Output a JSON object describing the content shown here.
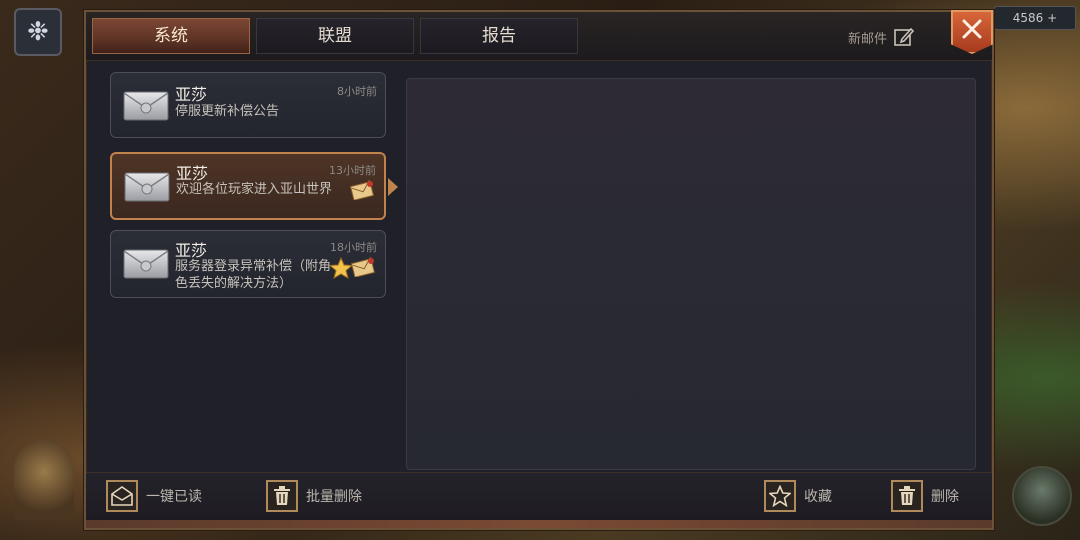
{
  "tabs": [
    {
      "label": "系统",
      "active": true
    },
    {
      "label": "联盟",
      "active": false
    },
    {
      "label": "报告",
      "active": false
    }
  ],
  "header": {
    "new_mail_label": "新邮件"
  },
  "mails": [
    {
      "sender": "亚莎",
      "subject": "停服更新补偿公告",
      "time": "8小时前"
    },
    {
      "sender": "亚莎",
      "subject": "欢迎各位玩家进入亚山世界",
      "time": "13小时前"
    },
    {
      "sender": "亚莎",
      "subject": "服务器登录异常补偿（附角色丢失的解决方法）",
      "time": "18小时前"
    }
  ],
  "footer": {
    "read_all": "一键已读",
    "batch_delete": "批量删除",
    "favorite": "收藏",
    "delete": "删除"
  },
  "background": {
    "resource_value": "4586"
  },
  "colors": {
    "accent": "#c0834c",
    "active_tab": "#6a3a2c",
    "close_button": "#c4502a",
    "panel": "#1f2028"
  }
}
